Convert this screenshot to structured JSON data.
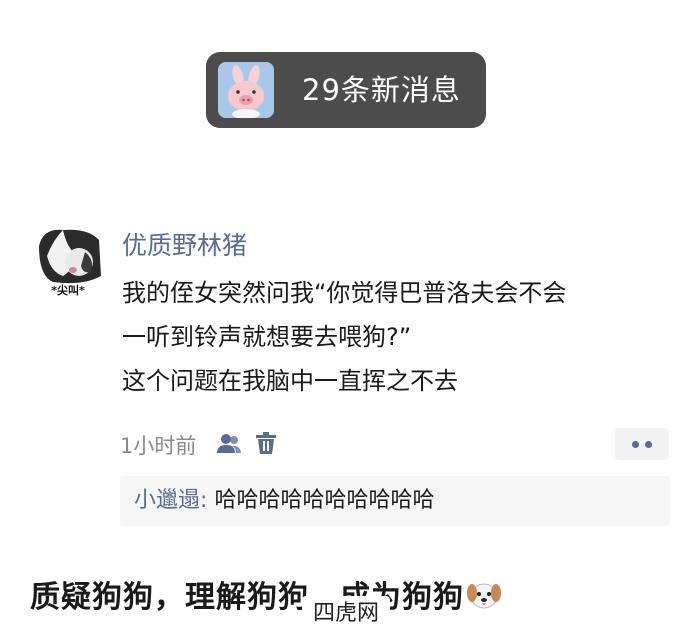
{
  "notification": {
    "text": "29条新消息",
    "avatar_icon": "pink-pig-with-bunny-ears"
  },
  "post": {
    "avatar_label": "*尖叫*",
    "username": "优质野林猪",
    "lines": [
      "我的侄女突然问我“你觉得巴普洛夫会不会",
      "一听到铃声就想要去喂狗?”",
      "这个问题在我脑中一直挥之不去"
    ],
    "time": "1小时前",
    "icons": [
      "friends-visibility-icon",
      "trash-icon",
      "more-icon"
    ],
    "comment": {
      "author": "小邋遢",
      "separator": ":",
      "text": "哈哈哈哈哈哈哈哈哈哈"
    }
  },
  "caption": {
    "text": "质疑狗狗，理解狗狗，成为狗狗",
    "emoji": "dog-face-icon"
  },
  "watermark": "四虎网",
  "colors": {
    "link": "#576b95",
    "notification_bg": "#4c4c4c",
    "comment_bg": "#f6f6f6"
  }
}
